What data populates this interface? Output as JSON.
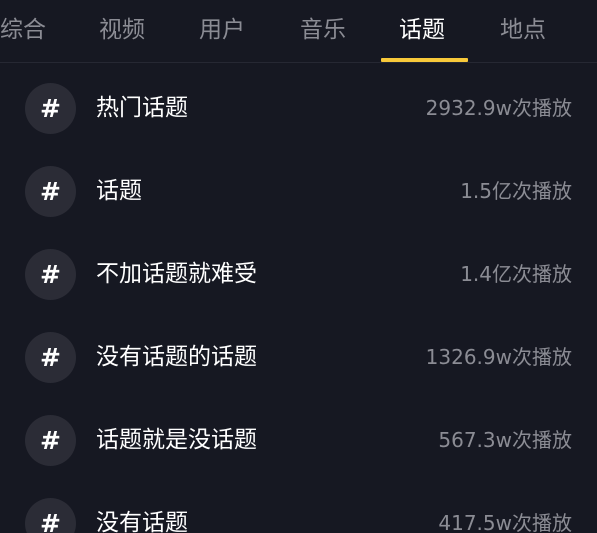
{
  "tabs": [
    {
      "label": "综合",
      "active": false
    },
    {
      "label": "视频",
      "active": false
    },
    {
      "label": "用户",
      "active": false
    },
    {
      "label": "音乐",
      "active": false
    },
    {
      "label": "话题",
      "active": true
    },
    {
      "label": "地点",
      "active": false
    }
  ],
  "colors": {
    "background": "#161822",
    "accent_underline": "#f8c93a",
    "text_primary": "#ffffff",
    "text_secondary": "#8b8c94",
    "icon_circle": "#2b2c36"
  },
  "topics": [
    {
      "icon": "#",
      "name": "热门话题",
      "plays": "2932.9w次播放"
    },
    {
      "icon": "#",
      "name": "话题",
      "plays": "1.5亿次播放"
    },
    {
      "icon": "#",
      "name": "不加话题就难受",
      "plays": "1.4亿次播放"
    },
    {
      "icon": "#",
      "name": "没有话题的话题",
      "plays": "1326.9w次播放"
    },
    {
      "icon": "#",
      "name": "话题就是没话题",
      "plays": "567.3w次播放"
    },
    {
      "icon": "#",
      "name": "没有话题",
      "plays": "417.5w次播放"
    }
  ]
}
